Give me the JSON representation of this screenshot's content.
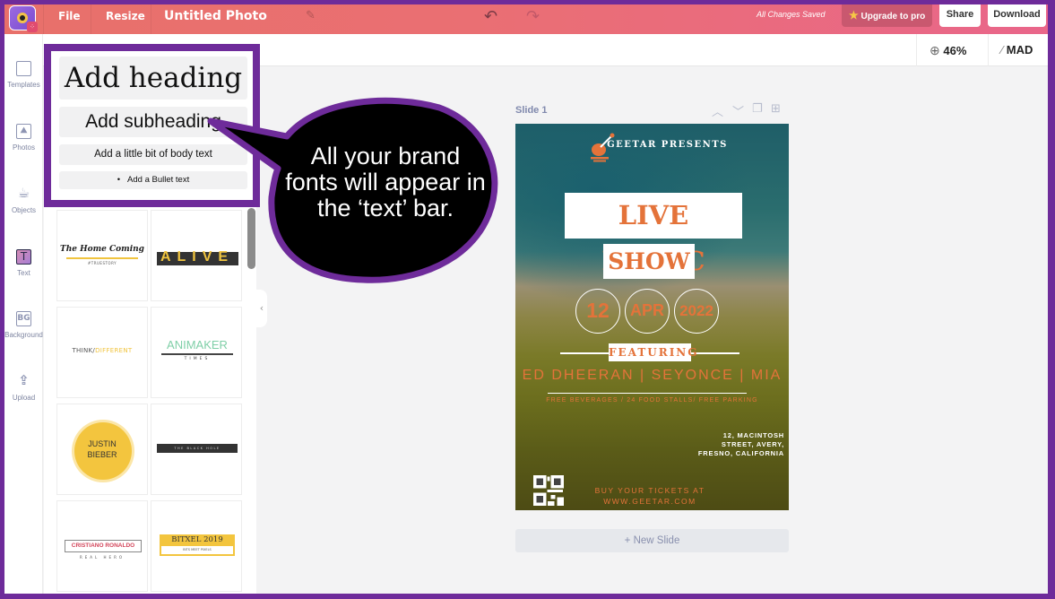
{
  "topbar": {
    "logo": "app-logo",
    "file_label": "File",
    "resize_label": "Resize",
    "doc_title": "Untitled Photo",
    "save_status": "All Changes Saved",
    "upgrade_label": "Upgrade to pro",
    "share_label": "Share",
    "download_label": "Download"
  },
  "subbar": {
    "zoom_level": "46%",
    "mad_label": "MAD"
  },
  "sidebar": {
    "items": [
      {
        "label": "Templates",
        "icon": "templates-icon"
      },
      {
        "label": "Photos",
        "icon": "photos-icon"
      },
      {
        "label": "Objects",
        "icon": "objects-icon"
      },
      {
        "label": "Text",
        "icon": "text-icon",
        "active": true
      },
      {
        "label": "Background",
        "icon": "background-icon",
        "glyph": "BG"
      },
      {
        "label": "Upload",
        "icon": "upload-icon"
      }
    ]
  },
  "text_panel": {
    "heading": "Add heading",
    "subheading": "Add subheading",
    "body": "Add a little bit of body text",
    "bullet": "Add a Bullet text",
    "templates": [
      {
        "title": "The Home Coming",
        "sub": "#TRUESTORY"
      },
      {
        "title": "ALIVE"
      },
      {
        "title": "THINK/",
        "accent": "DIFFERENT"
      },
      {
        "title": "ANIMAKER",
        "sub": "TIMES"
      },
      {
        "title": "JUSTIN",
        "line2": "BIEBER"
      },
      {
        "title": "THE BLACK HOLE"
      },
      {
        "title": "CRISTIANO RONALDO",
        "sub": "REAL HERO"
      },
      {
        "title": "BITXEL 2019",
        "sub": "BITS MEET PIXELS"
      }
    ]
  },
  "callout": {
    "text_line1": "All your brand",
    "text_line2": "fonts will appear in",
    "text_line3": "the ‘text’ bar."
  },
  "canvas": {
    "slide_label": "Slide 1",
    "new_slide_label": "+ New Slide",
    "poster": {
      "presents": "GEETAR PRESENTS",
      "title_line1": "LIVE MUSIC",
      "title_line2": "SHOW",
      "day": "12",
      "month": "APR",
      "year": "2022",
      "featuring": "FEATURING",
      "artists": "ED DHEERAN | SEYONCE | MIA",
      "perks": "FREE BEVERAGES / 24 FOOD STALLS/ FREE PARKING",
      "address_line1": "12, MACINTOSH",
      "address_line2": "STREET, AVERY,",
      "address_line3": "FRESNO, CALIFORNIA",
      "tickets_line1": "BUY YOUR TICKETS AT",
      "tickets_line2": "WWW.GEETAR.COM"
    }
  },
  "colors": {
    "frame": "#6e2b9a",
    "topbar_start": "#e8706a",
    "topbar_end": "#e9668a",
    "poster_accent": "#e4733a"
  }
}
